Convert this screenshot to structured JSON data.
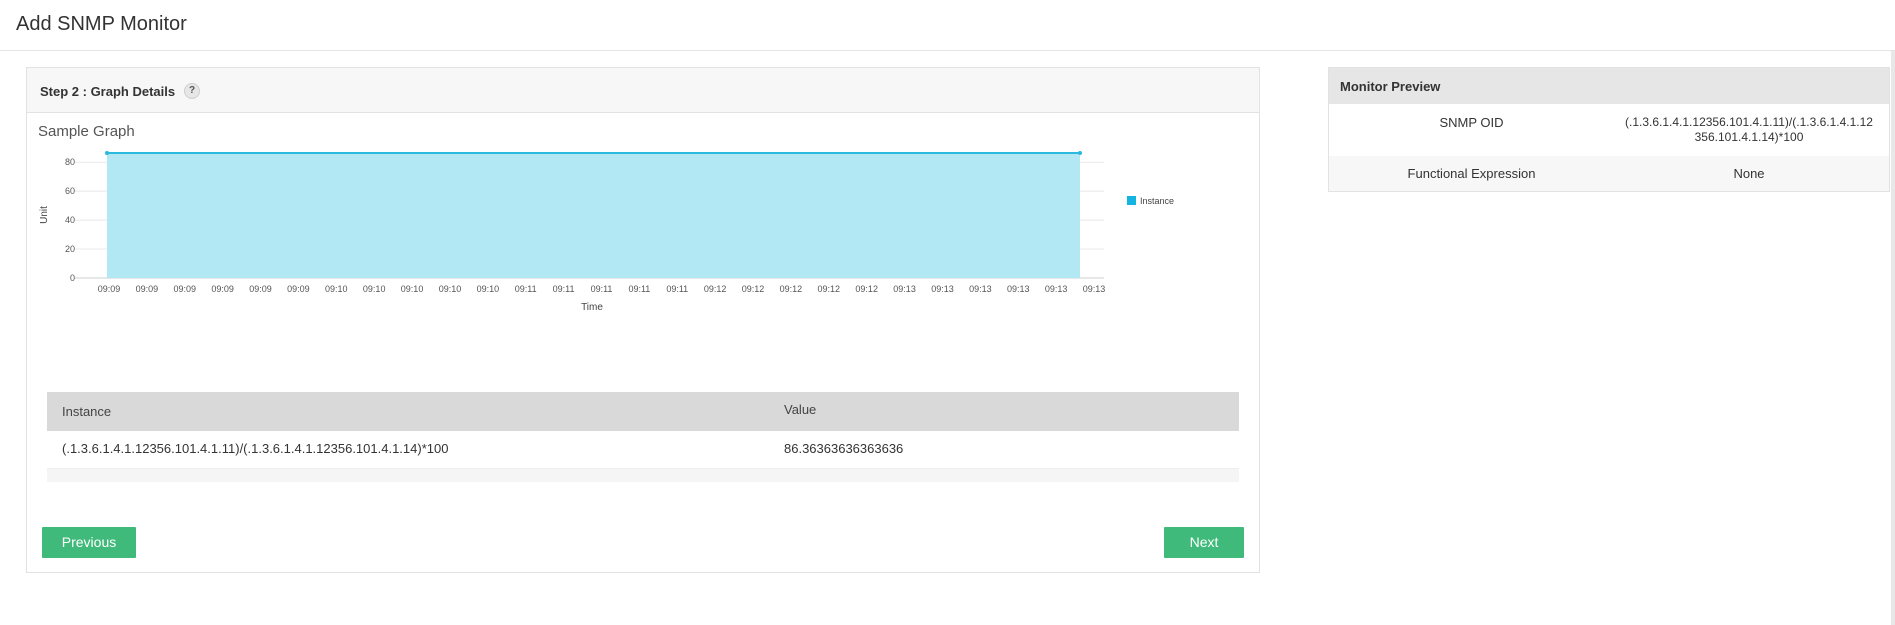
{
  "page": {
    "title": "Add SNMP Monitor"
  },
  "step": {
    "title": "Step 2 : Graph Details",
    "help": "?",
    "graph_title": "Sample Graph"
  },
  "chart_data": {
    "type": "area",
    "x": [
      "09:09",
      "09:09",
      "09:09",
      "09:09",
      "09:09",
      "09:09",
      "09:10",
      "09:10",
      "09:10",
      "09:10",
      "09:10",
      "09:11",
      "09:11",
      "09:11",
      "09:11",
      "09:11",
      "09:12",
      "09:12",
      "09:12",
      "09:12",
      "09:12",
      "09:13",
      "09:13",
      "09:13",
      "09:13",
      "09:13",
      "09:13"
    ],
    "series": [
      {
        "name": "Instance",
        "values": [
          86.36,
          86.36,
          86.36,
          86.36,
          86.36,
          86.36,
          86.36,
          86.36,
          86.36,
          86.36,
          86.36,
          86.36,
          86.36,
          86.36,
          86.36,
          86.36,
          86.36,
          86.36,
          86.36,
          86.36,
          86.36,
          86.36,
          86.36,
          86.36,
          86.36,
          86.36,
          86.36
        ]
      }
    ],
    "xlabel": "Time",
    "ylabel": "Unit",
    "ylim": [
      0,
      86.36
    ],
    "yticks": [
      0,
      20,
      40,
      60,
      80
    ],
    "grid": true,
    "legend": "top-right",
    "colors": {
      "line": "#2bb9dd",
      "fill": "#b2e8f4",
      "legend": "#14b4e0"
    }
  },
  "table": {
    "headers": [
      "Instance",
      "Value"
    ],
    "rows": [
      [
        "(.1.3.6.1.4.1.12356.101.4.1.11)/(.1.3.6.1.4.1.12356.101.4.1.14)*100",
        "86.36363636363636"
      ]
    ]
  },
  "buttons": {
    "previous": "Previous",
    "next": "Next"
  },
  "preview": {
    "title": "Monitor Preview",
    "rows": [
      {
        "key": "SNMP OID",
        "value_line1": "(.1.3.6.1.4.1.12356.101.4.1.11)/(.1.3.6.1.4.1.12",
        "value_line2": "356.101.4.1.14)*100"
      },
      {
        "key": "Functional Expression",
        "value": "None"
      }
    ]
  },
  "colors": {
    "accent": "#3fba7a"
  }
}
